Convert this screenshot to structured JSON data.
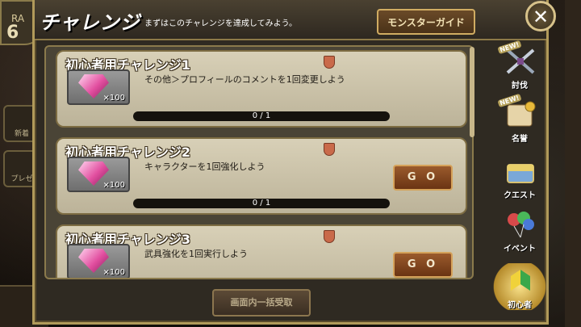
{
  "header": {
    "title": "チャレンジ",
    "subtitle": "まずはこのチャレンジを達成してみよう。",
    "guide_button": "モンスターガイド",
    "close_symbol": "✕"
  },
  "challenges": [
    {
      "title": "初心者用チャレンジ1",
      "description": "その他＞プロフィールのコメントを1回変更しよう",
      "reward_qty": "×100",
      "progress": "0 / 1",
      "progress_fraction": 0,
      "go_label": ""
    },
    {
      "title": "初心者用チャレンジ2",
      "description": "キャラクターを1回強化しよう",
      "reward_qty": "×100",
      "progress": "0 / 1",
      "progress_fraction": 0,
      "go_label": "G O"
    },
    {
      "title": "初心者用チャレンジ3",
      "description": "武具強化を1回実行しよう",
      "reward_qty": "×100",
      "progress": "",
      "progress_fraction": 0,
      "go_label": "G O"
    }
  ],
  "bulk_button": "画面内一括受取",
  "tabs": [
    {
      "label": "討伐",
      "badge": "NEW!",
      "icon": "crossed-swords-icon"
    },
    {
      "label": "名誉",
      "badge": "NEW!",
      "icon": "scroll-medal-icon"
    },
    {
      "label": "クエスト",
      "badge": "",
      "icon": "treasure-chest-icon"
    },
    {
      "label": "イベント",
      "badge": "",
      "icon": "balloons-icon"
    },
    {
      "label": "初心者",
      "badge": "",
      "icon": "beginner-leaf-icon",
      "active": true
    }
  ],
  "background": {
    "rank_label": "RA",
    "rank_value": "6",
    "left_tile_1": "新着",
    "left_tile_2": "プレゼ"
  }
}
